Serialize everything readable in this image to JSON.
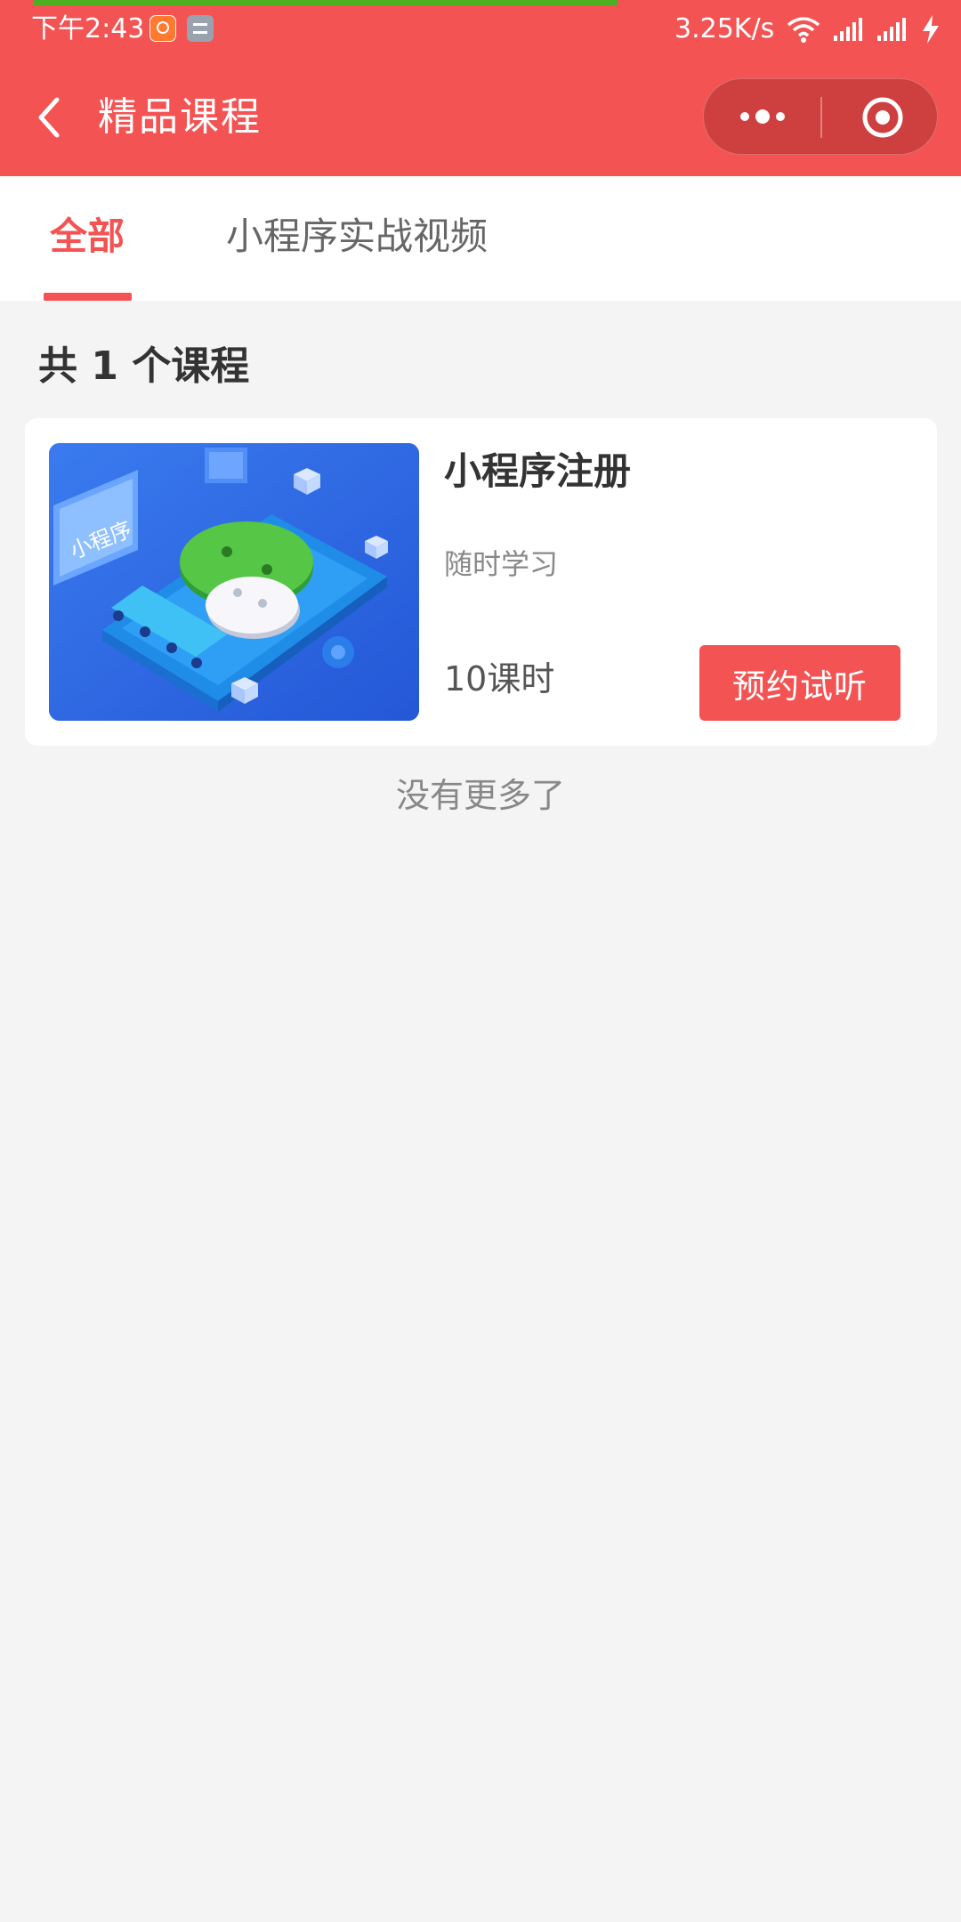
{
  "status_bar": {
    "time": "下午2:43",
    "network_speed": "3.25K/s",
    "icons": [
      "app-notification-icon",
      "app-notification-icon-2",
      "wifi-icon",
      "signal-icon",
      "signal-icon-2",
      "charging-icon"
    ]
  },
  "header": {
    "title": "精品课程",
    "icons": [
      "back-arrow-icon",
      "more-dots-icon",
      "close-circle-icon"
    ]
  },
  "tabs": [
    {
      "label": "全部",
      "active": true
    },
    {
      "label": "小程序实战视频",
      "active": false
    }
  ],
  "summary": "共 1 个课程",
  "courses": [
    {
      "title": "小程序注册",
      "subtitle": "随时学习",
      "hours": "10课时",
      "button": "预约试听",
      "thumbnail_text": "小程序"
    }
  ],
  "footer_text": "没有更多了",
  "colors": {
    "primary": "#f45353",
    "background": "#f4f4f4",
    "card": "#ffffff",
    "text_dark": "#333333",
    "text_gray": "#888888",
    "loading_bar": "#4caf1f"
  }
}
